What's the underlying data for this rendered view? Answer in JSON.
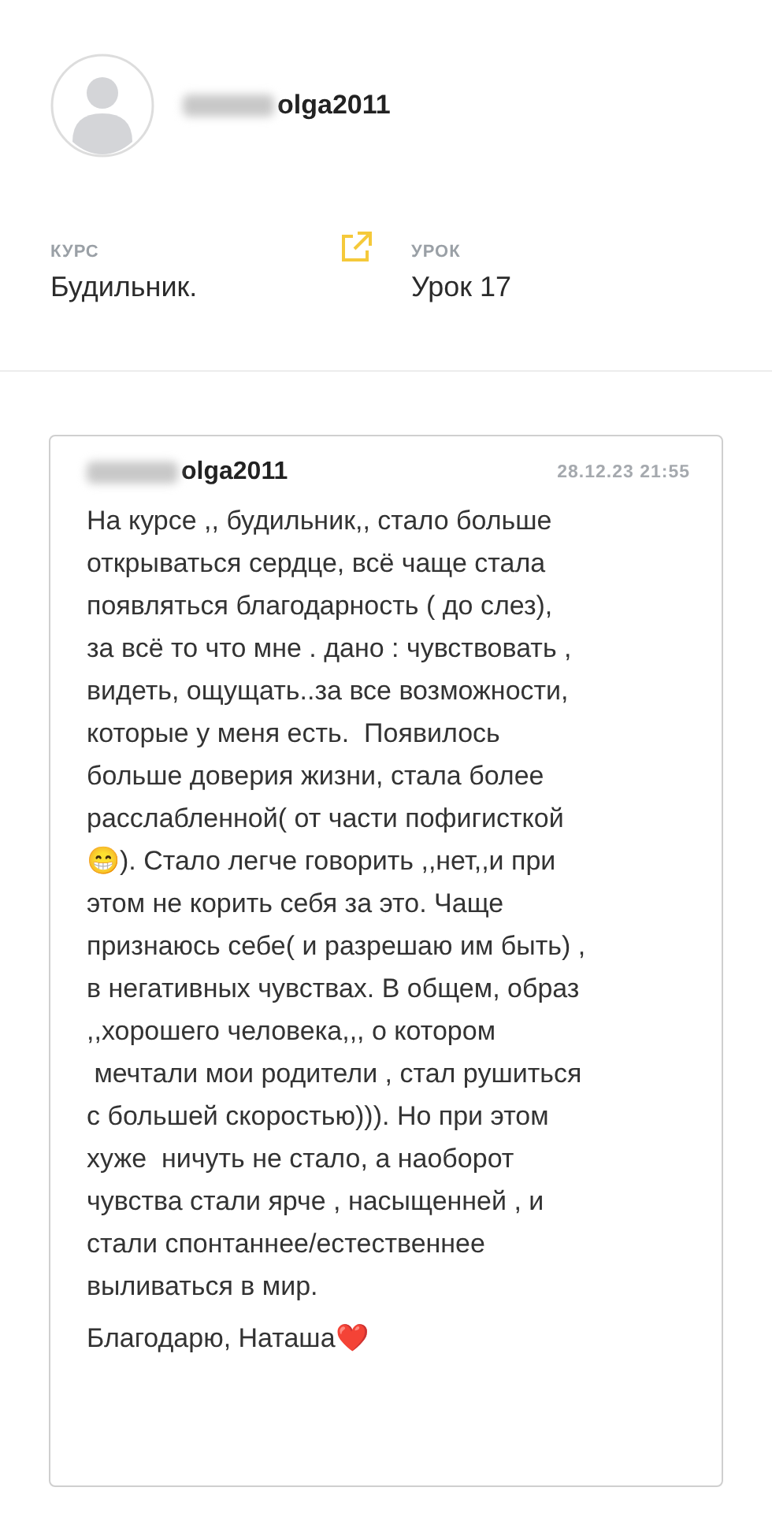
{
  "profile": {
    "username": "olga2011",
    "username_blurred": true
  },
  "info": [
    {
      "label": "КУРС",
      "value": "Будильник.",
      "link": true
    },
    {
      "label": "УРОК",
      "value": "Урок 17",
      "link": false
    }
  ],
  "comment": {
    "author": "olga2011",
    "author_blurred": true,
    "date": "28.12.23 21:55",
    "paragraphs": [
      "На курсе ,, будильник,, стало больше\nоткрываться сердце, всё чаще стала\nпоявляться благодарность ( до слез),\nза всё то что мне . дано : чувствовать ,\nвидеть, ощущать..за все возможности,\nкоторые у меня есть.  Появилось\nбольше доверия жизни, стала более\nрасслабленной( от части пофигисткой\n😁). Стало легче говорить ,,нет,,и при\nэтом не корить себя за это. Чаще\nпризнаюсь себе( и разрешаю им быть) ,\nв негативных чувствах. В общем, образ\n,,хорошего человека,,, о котором\n мечтали мои родители , стал рушиться\nс большей скоростью))). Но при этом\nхуже  ничуть не стало, а наоборот\nчувства стали ярче , насыщенней , и\nстали спонтаннее/естественнее\nвыливаться в мир.",
      "Благодарю, Наташа❤️"
    ]
  }
}
